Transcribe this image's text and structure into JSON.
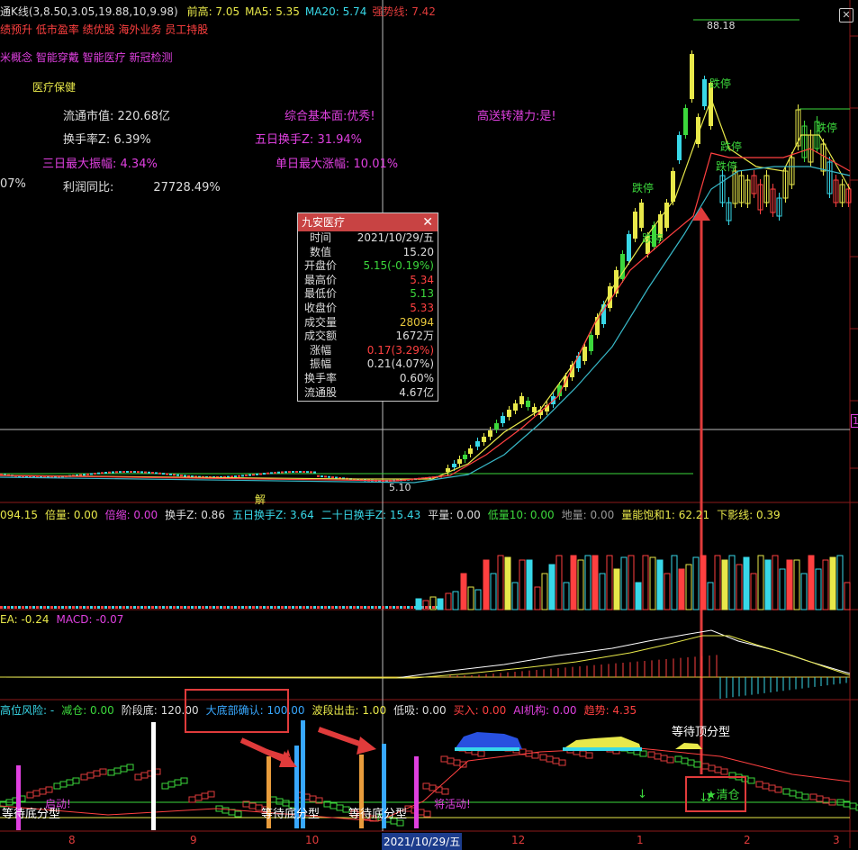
{
  "header": {
    "main_label": "通K线(3,8.50,3.05,19.88,10,9.98)",
    "items": [
      {
        "label": "前高:",
        "value": "7.05",
        "color": "#e8e84a"
      },
      {
        "label": "MA5:",
        "value": "5.35",
        "color": "#e8e84a"
      },
      {
        "label": "MA20:",
        "value": "5.74",
        "color": "#38d8e8"
      },
      {
        "label": "强势线:",
        "value": "7.42",
        "color": "#e03b3b"
      }
    ],
    "tags1": "绩预升 低市盈率 绩优股 海外业务 员工持股",
    "tags2": "米概念 智能穿戴 智能医疗 新冠检测",
    "tag3": "医疗保健"
  },
  "stats": [
    {
      "label": "流通市值:",
      "value": "220.68亿"
    },
    {
      "label": "换手率Z:",
      "value": "6.39%"
    },
    {
      "label": "三日最大振幅:",
      "value": "4.34%"
    },
    {
      "label": "07%",
      "value": ""
    },
    {
      "label": "利润同比:",
      "value": "27728.49%"
    },
    {
      "label": "综合基本面:",
      "value": "优秀!"
    },
    {
      "label": "五日换手Z:",
      "value": "31.94%"
    },
    {
      "label": "单日最大涨幅:",
      "value": "10.01%"
    },
    {
      "label": "高送转潜力:",
      "value": "是!"
    }
  ],
  "price_labels": {
    "high": "88.18",
    "low": "5.10",
    "marker": "解",
    "right_tick": "1"
  },
  "limit_up_labels": [
    "跌停",
    "跌停",
    "跌停",
    "跌停",
    "跌停",
    "跌停"
  ],
  "popup": {
    "title": "九安医疗",
    "rows": [
      {
        "k": "时间",
        "v": "2021/10/29/五",
        "c": "#dddddd"
      },
      {
        "k": "数值",
        "v": "15.20",
        "c": "#dddddd"
      },
      {
        "k": "开盘价",
        "v": "5.15(-0.19%)",
        "c": "#3cd83c"
      },
      {
        "k": "最高价",
        "v": "5.34",
        "c": "#ff4040"
      },
      {
        "k": "最低价",
        "v": "5.13",
        "c": "#3cd83c"
      },
      {
        "k": "收盘价",
        "v": "5.33",
        "c": "#ff4040"
      },
      {
        "k": "成交量",
        "v": "28094",
        "c": "#e8c83c"
      },
      {
        "k": "成交额",
        "v": "1672万",
        "c": "#dddddd"
      },
      {
        "k": "涨幅",
        "v": "0.17(3.29%)",
        "c": "#ff4040"
      },
      {
        "k": "振幅",
        "v": "0.21(4.07%)",
        "c": "#dddddd"
      },
      {
        "k": "换手率",
        "v": "0.60%",
        "c": "#dddddd"
      },
      {
        "k": "流通股",
        "v": "4.67亿",
        "c": "#dddddd"
      }
    ]
  },
  "vol_header": [
    {
      "t": "094.15",
      "c": "#e8e84a"
    },
    {
      "t": "倍量: 0.00",
      "c": "#e8e84a"
    },
    {
      "t": "倍缩: 0.00",
      "c": "#e040e0"
    },
    {
      "t": "换手Z: 0.86",
      "c": "#dddddd"
    },
    {
      "t": "五日换手Z: 3.64",
      "c": "#38d8e8"
    },
    {
      "t": "二十日换手Z: 15.43",
      "c": "#38d8e8"
    },
    {
      "t": "平量: 0.00",
      "c": "#dddddd"
    },
    {
      "t": "低量10: 0.00",
      "c": "#3cd83c"
    },
    {
      "t": "地量: 0.00",
      "c": "#999999"
    },
    {
      "t": "量能饱和1: 62.21",
      "c": "#e8e84a"
    },
    {
      "t": "下影线: 0.39",
      "c": "#e8e84a"
    }
  ],
  "macd_header": [
    {
      "t": "EA: -0.24",
      "c": "#e8e84a"
    },
    {
      "t": "MACD: -0.07",
      "c": "#e040e0"
    }
  ],
  "ind_header": [
    {
      "t": "高位风险: -",
      "c": "#38d8e8"
    },
    {
      "t": "减仓: 0.00",
      "c": "#3cd83c"
    },
    {
      "t": "阶段底: 120.00",
      "c": "#dddddd"
    },
    {
      "t": "大底部确认: 100.00",
      "c": "#38a8ff"
    },
    {
      "t": "波段出击: 1.00",
      "c": "#e8e84a"
    },
    {
      "t": "低吸: 0.00",
      "c": "#dddddd"
    },
    {
      "t": "买入: 0.00",
      "c": "#ff4040"
    },
    {
      "t": "AI机构: 0.00",
      "c": "#e040e0"
    },
    {
      "t": "趋势: 4.35",
      "c": "#ff4040"
    }
  ],
  "ind_labels": {
    "wait_top": "等待顶分型",
    "clear": "清仓",
    "wait_bottom_1": "等待底分型",
    "wait_bottom_2": "等待底分型",
    "wait_bottom_3": "等待底分型",
    "start": "启动!",
    "activate": "将活动!"
  },
  "x_axis": {
    "ticks": [
      "8",
      "9",
      "10",
      "12",
      "1",
      "2",
      "3"
    ],
    "selected": "2021/10/29/五"
  },
  "close_icon": "close-icon"
}
